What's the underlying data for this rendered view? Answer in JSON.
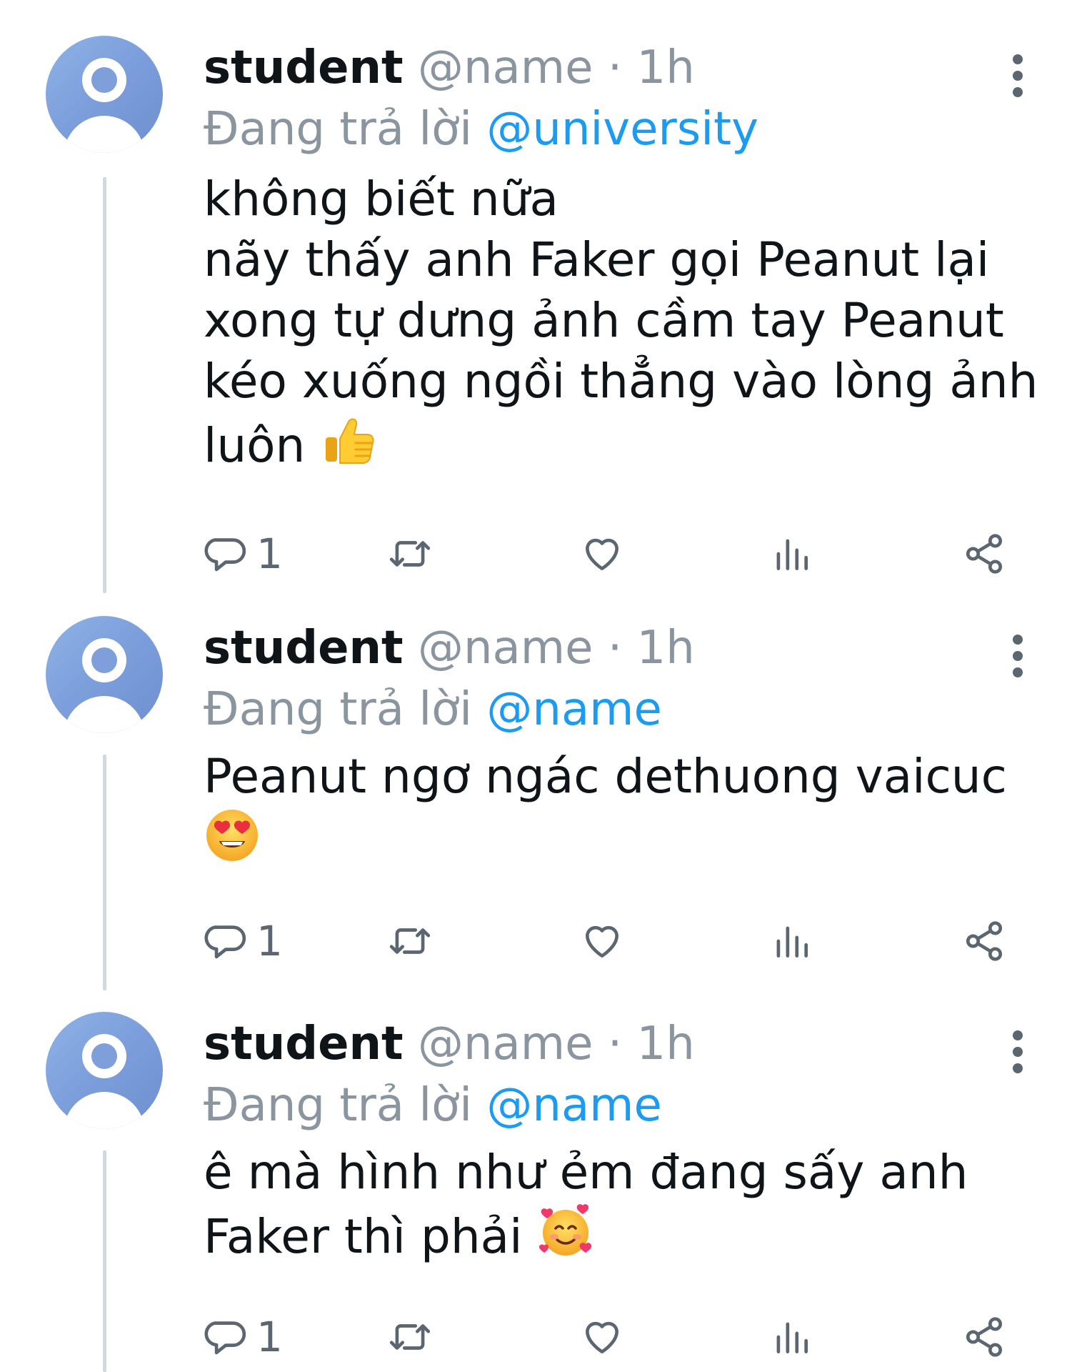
{
  "tweets": [
    {
      "display_name": "student",
      "handle": "@name",
      "separator": "·",
      "time": "1h",
      "reply_prefix": "Đang trả lời",
      "reply_to": "@university",
      "lines": [
        "không biết nữa",
        "nãy thấy anh Faker gọi Peanut lại",
        "xong tự dưng ảnh cầm tay Peanut",
        "kéo xuống ngồi thẳng vào lòng ảnh",
        "luôn"
      ],
      "emoji": "thumbs-up",
      "reply_count": "1"
    },
    {
      "display_name": "student",
      "handle": "@name",
      "separator": "·",
      "time": "1h",
      "reply_prefix": "Đang trả lời",
      "reply_to": "@name",
      "lines": [
        "Peanut ngơ ngác dethuong vaicuc"
      ],
      "emoji": "heart-eyes",
      "reply_count": "1"
    },
    {
      "display_name": "student",
      "handle": "@name",
      "separator": "·",
      "time": "1h",
      "reply_prefix": "Đang trả lời",
      "reply_to": "@name",
      "lines": [
        "ê mà hình như ẻm đang sấy anh",
        "Faker thì phải"
      ],
      "emoji": "smiling-face-with-hearts",
      "reply_count": "1"
    }
  ],
  "icons": {
    "reply": "reply-icon",
    "retweet": "retweet-icon",
    "like": "heart-icon",
    "views": "views-icon",
    "share": "share-icon",
    "more": "more-vertical-icon"
  },
  "colors": {
    "mention": "#1d9bf0",
    "muted": "#8a959f",
    "icon": "#5b6670",
    "thread_line": "#cfd9de"
  }
}
